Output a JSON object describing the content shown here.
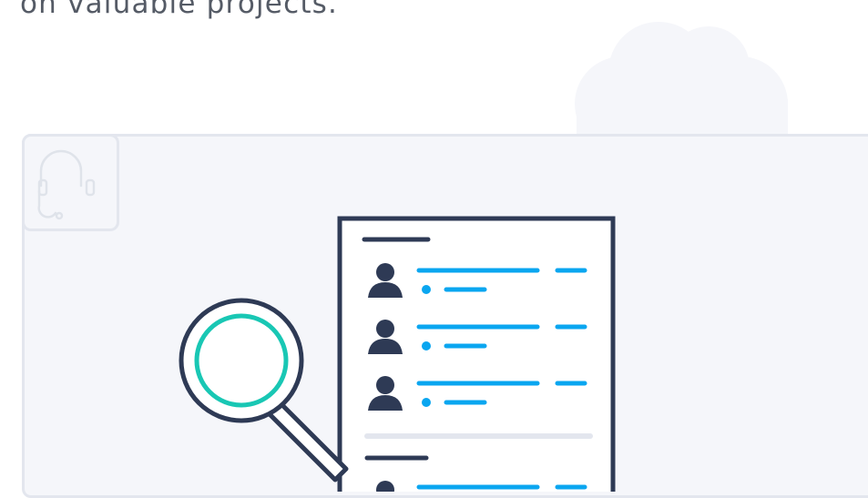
{
  "headline": {
    "text": "on valuable projects."
  },
  "colors": {
    "navy": "#2e3a55",
    "accent_blue": "#0aa6f0",
    "teal": "#19c7b4",
    "panel_bg": "#f5f6fa",
    "panel_border": "#e3e6ee",
    "cloud": "#f5f6fa"
  },
  "icons": {
    "support": "headset-icon",
    "search": "magnifying-glass-icon",
    "person": "user-icon",
    "cloud": "cloud-shape"
  },
  "document": {
    "rows": [
      {
        "name": "user-row-1"
      },
      {
        "name": "user-row-2"
      },
      {
        "name": "user-row-3"
      },
      {
        "name": "user-row-4"
      }
    ]
  }
}
